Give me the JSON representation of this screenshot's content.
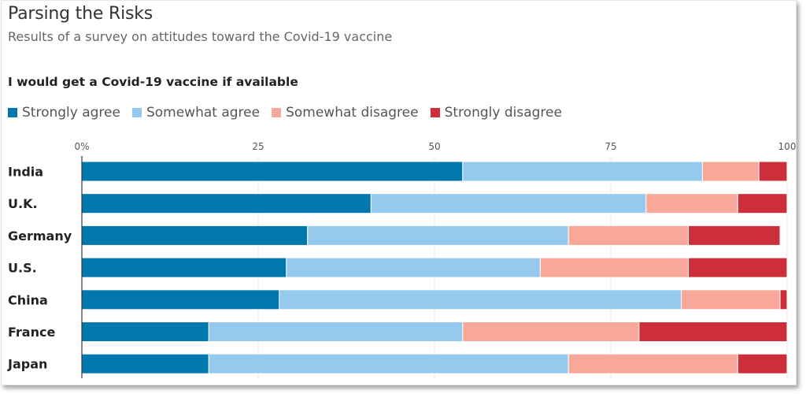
{
  "chart_data": {
    "type": "bar",
    "orientation": "horizontal",
    "stacked": true,
    "title": "Parsing the Risks",
    "subtitle": "Results of a survey on attitudes toward the Covid-19 vaccine",
    "question": "I would get a Covid-19 vaccine if available",
    "xlabel": "",
    "ylabel": "",
    "xlim": [
      0,
      100
    ],
    "ticks": [
      0,
      25,
      50,
      75,
      100
    ],
    "tick_labels": [
      "0%",
      "25",
      "50",
      "75",
      "100"
    ],
    "grid": true,
    "legend_position": "top-left",
    "categories": [
      "India",
      "U.K.",
      "Germany",
      "U.S.",
      "China",
      "France",
      "Japan"
    ],
    "series": [
      {
        "name": "Strongly agree",
        "color": "#0077ad",
        "values": [
          54,
          41,
          32,
          29,
          28,
          18,
          18
        ]
      },
      {
        "name": "Somewhat agree",
        "color": "#95caee",
        "values": [
          34,
          39,
          37,
          36,
          57,
          36,
          51
        ]
      },
      {
        "name": "Somewhat disagree",
        "color": "#f7a898",
        "values": [
          8,
          13,
          17,
          21,
          14,
          25,
          24
        ]
      },
      {
        "name": "Strongly disagree",
        "color": "#cd2f3a",
        "values": [
          4,
          7,
          13,
          14,
          1,
          21,
          7
        ]
      }
    ]
  }
}
